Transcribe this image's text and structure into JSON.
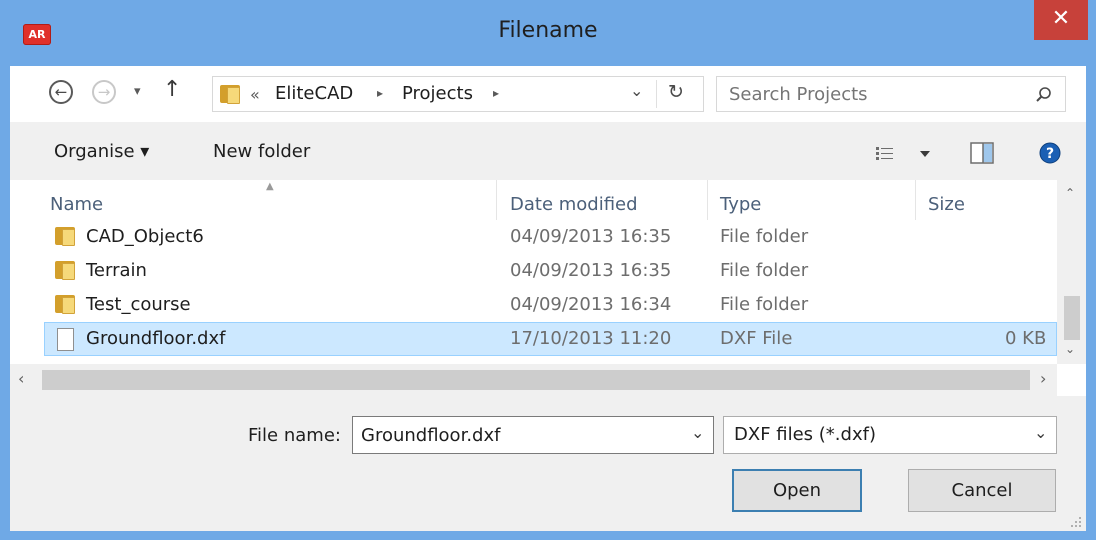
{
  "window": {
    "title": "Filename",
    "app_icon_text": "AR",
    "close_glyph": "✕"
  },
  "nav": {
    "back_glyph": "←",
    "forward_glyph": "→",
    "recent_glyph": "▾",
    "up_glyph": "↑",
    "breadcrumb_overflow": "«",
    "breadcrumb": [
      "EliteCAD",
      "Projects"
    ],
    "breadcrumb_sep": "▸",
    "address_dropdown_glyph": "⌄",
    "refresh_glyph": "↻",
    "search_placeholder": "Search Projects"
  },
  "toolbar": {
    "organise_label": "Organise ▾",
    "new_folder_label": "New folder"
  },
  "list": {
    "columns": [
      "Name",
      "Date modified",
      "Type",
      "Size"
    ],
    "rows": [
      {
        "name": "CAD_Object6",
        "date": "04/09/2013 16:35",
        "type": "File folder",
        "size": "",
        "kind": "folder",
        "selected": false
      },
      {
        "name": "Terrain",
        "date": "04/09/2013 16:35",
        "type": "File folder",
        "size": "",
        "kind": "folder",
        "selected": false
      },
      {
        "name": "Test_course",
        "date": "04/09/2013 16:34",
        "type": "File folder",
        "size": "",
        "kind": "folder",
        "selected": false
      },
      {
        "name": "Groundfloor.dxf",
        "date": "17/10/2013 11:20",
        "type": "DXF File",
        "size": "0 KB",
        "kind": "file",
        "selected": true
      }
    ]
  },
  "footer": {
    "file_name_label": "File name:",
    "file_name_value": "Groundfloor.dxf",
    "filter_value": "DXF files (*.dxf)",
    "open_label": "Open",
    "cancel_label": "Cancel"
  },
  "colors": {
    "title_bar": "#6fa9e6",
    "close_button": "#c7413a",
    "selection": "#cce8ff",
    "folder": "#f6d97a",
    "help": "#1a5fb4"
  }
}
